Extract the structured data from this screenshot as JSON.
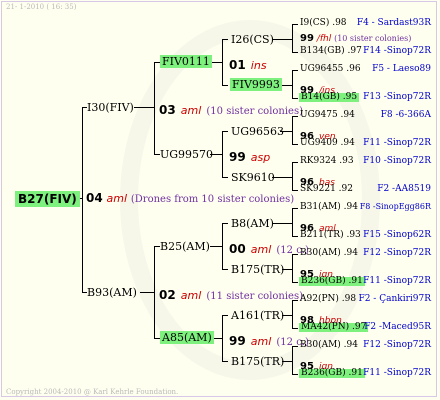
{
  "header": "21-  1-2010 ( 16: 35)",
  "footer": "Copyright 2004-2010 @ Karl Kehrle Foundation.",
  "root": {
    "name": "B27(FIV)",
    "year": "04",
    "mark": "aml",
    "note": "(Drones from 10 sister colonies)"
  },
  "gen1": [
    {
      "name": "I30(FIV)",
      "year": "03",
      "mark": "aml",
      "note": "(10 sister colonies)"
    },
    {
      "name": "B93(AM)",
      "year": "02",
      "mark": "aml",
      "note": "(11 sister colonies)"
    }
  ],
  "gen2": [
    {
      "name": "FIV0111",
      "year": "01",
      "mark": "ins"
    },
    {
      "name": "UG99570",
      "year": "99",
      "mark": "asp"
    },
    {
      "name": "B25(AM)",
      "year": "00",
      "mark": "aml",
      "note": "(12 c.)"
    },
    {
      "name": "A85(AM)",
      "year": "99",
      "mark": "aml",
      "note": "(12 c.)"
    }
  ],
  "gen3": [
    {
      "name": "I26(CS)",
      "year": "99",
      "mark": "/fhl",
      "note": "(10 sister colonies)"
    },
    {
      "name": "FIV9993",
      "year": "99",
      "mark": "/ins"
    },
    {
      "name": "UG96563",
      "year": "96",
      "mark": "ven"
    },
    {
      "name": "SK9610",
      "year": "96",
      "mark": "bas"
    },
    {
      "name": "B8(AM)",
      "year": "96",
      "mark": "aml"
    },
    {
      "name": "B175(TR)",
      "year": "95",
      "mark": "ign"
    },
    {
      "name": "A161(TR)",
      "year": "98",
      "mark": "hbpn"
    },
    {
      "name": "B175(TR)",
      "year": "95",
      "mark": "ign"
    }
  ],
  "gen4": [
    {
      "name": "I9(CS) .98",
      "code": "F4 - Sardast93R"
    },
    {
      "name": "B134(GB) .97",
      "code": "F14 -Sinop72R"
    },
    {
      "name": "UG96455 .96",
      "code": "F5 - Laeso89"
    },
    {
      "name": "B14(GB) .95",
      "code": "F13 -Sinop72R"
    },
    {
      "name": "UG9475 .94",
      "code": "F8 -6-366A"
    },
    {
      "name": "UG9409 .94",
      "code": "F11 -Sinop72R"
    },
    {
      "name": "RK9324 .93",
      "code": "F10 -Sinop72R"
    },
    {
      "name": "SK9221 .92",
      "code": "F2 -AA8519"
    },
    {
      "name": "B31(AM) .94",
      "code": "F8 -SinopEgg86R"
    },
    {
      "name": "B211(TR) .93",
      "code": "F15 -Sinop62R"
    },
    {
      "name": "B30(AM) .94",
      "code": "F12 -Sinop72R"
    },
    {
      "name": "B236(GB) .91",
      "code": "F11 -Sinop72R"
    },
    {
      "name": "A92(PN) .98",
      "code": "F2 - Çankiri97R"
    },
    {
      "name": "MA42(PN) .97",
      "code": "F2 -Maced95R"
    },
    {
      "name": "B30(AM) .94",
      "code": "F12 -Sinop72R"
    },
    {
      "name": "B236(GB) .91",
      "code": "F11 -Sinop72R"
    }
  ],
  "colors": {
    "highlight": "#7df07d",
    "mark": "#cc0000",
    "sister": "#7030a0",
    "code": "#0000cc"
  }
}
